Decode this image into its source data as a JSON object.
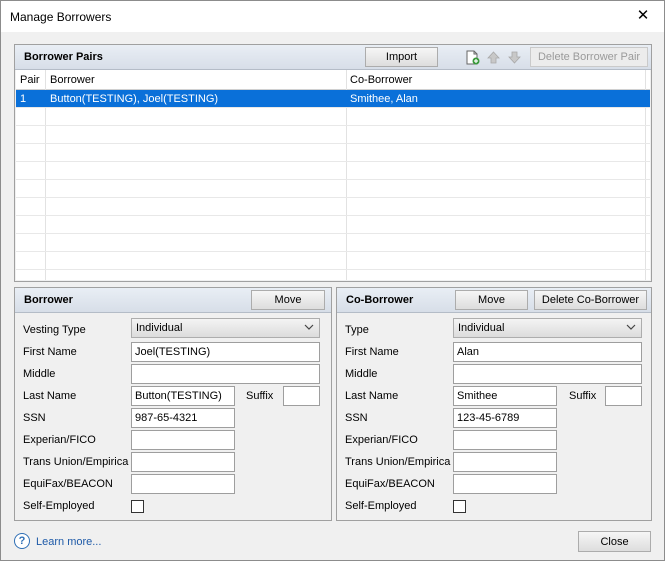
{
  "window": {
    "title": "Manage Borrowers",
    "close_glyph": "✕"
  },
  "pairs_panel": {
    "title": "Borrower Pairs",
    "import_label": "Import",
    "delete_pair_label": "Delete Borrower Pair",
    "columns": [
      "Pair",
      "Borrower",
      "Co-Borrower"
    ],
    "rows": [
      {
        "pair": "1",
        "borrower": "Button(TESTING), Joel(TESTING)",
        "co_borrower": "Smithee, Alan"
      }
    ],
    "icons": [
      "add-pair-icon",
      "move-up-icon",
      "move-down-icon"
    ]
  },
  "borrower": {
    "title": "Borrower",
    "move_label": "Move",
    "labels": {
      "vesting_type": "Vesting Type",
      "first_name": "First Name",
      "middle": "Middle",
      "last_name": "Last Name",
      "suffix": "Suffix",
      "ssn": "SSN",
      "experian": "Experian/FICO",
      "trans_union": "Trans Union/Empirica",
      "equifax": "EquiFax/BEACON",
      "self_employed": "Self-Employed"
    },
    "values": {
      "vesting_type": "Individual",
      "first_name": "Joel(TESTING)",
      "middle": "",
      "last_name": "Button(TESTING)",
      "suffix": "",
      "ssn": "987-65-4321",
      "experian": "",
      "trans_union": "",
      "equifax": ""
    }
  },
  "co_borrower": {
    "title": "Co-Borrower",
    "move_label": "Move",
    "delete_label": "Delete Co-Borrower",
    "labels": {
      "type": "Type",
      "first_name": "First Name",
      "middle": "Middle",
      "last_name": "Last Name",
      "suffix": "Suffix",
      "ssn": "SSN",
      "experian": "Experian/FICO",
      "trans_union": "Trans Union/Empirica",
      "equifax": "EquiFax/BEACON",
      "self_employed": "Self-Employed"
    },
    "values": {
      "type": "Individual",
      "first_name": "Alan",
      "middle": "",
      "last_name": "Smithee",
      "suffix": "",
      "ssn": "123-45-6789",
      "experian": "",
      "trans_union": "",
      "equifax": ""
    }
  },
  "footer": {
    "help_glyph": "?",
    "learn_more": "Learn more...",
    "close_label": "Close"
  }
}
